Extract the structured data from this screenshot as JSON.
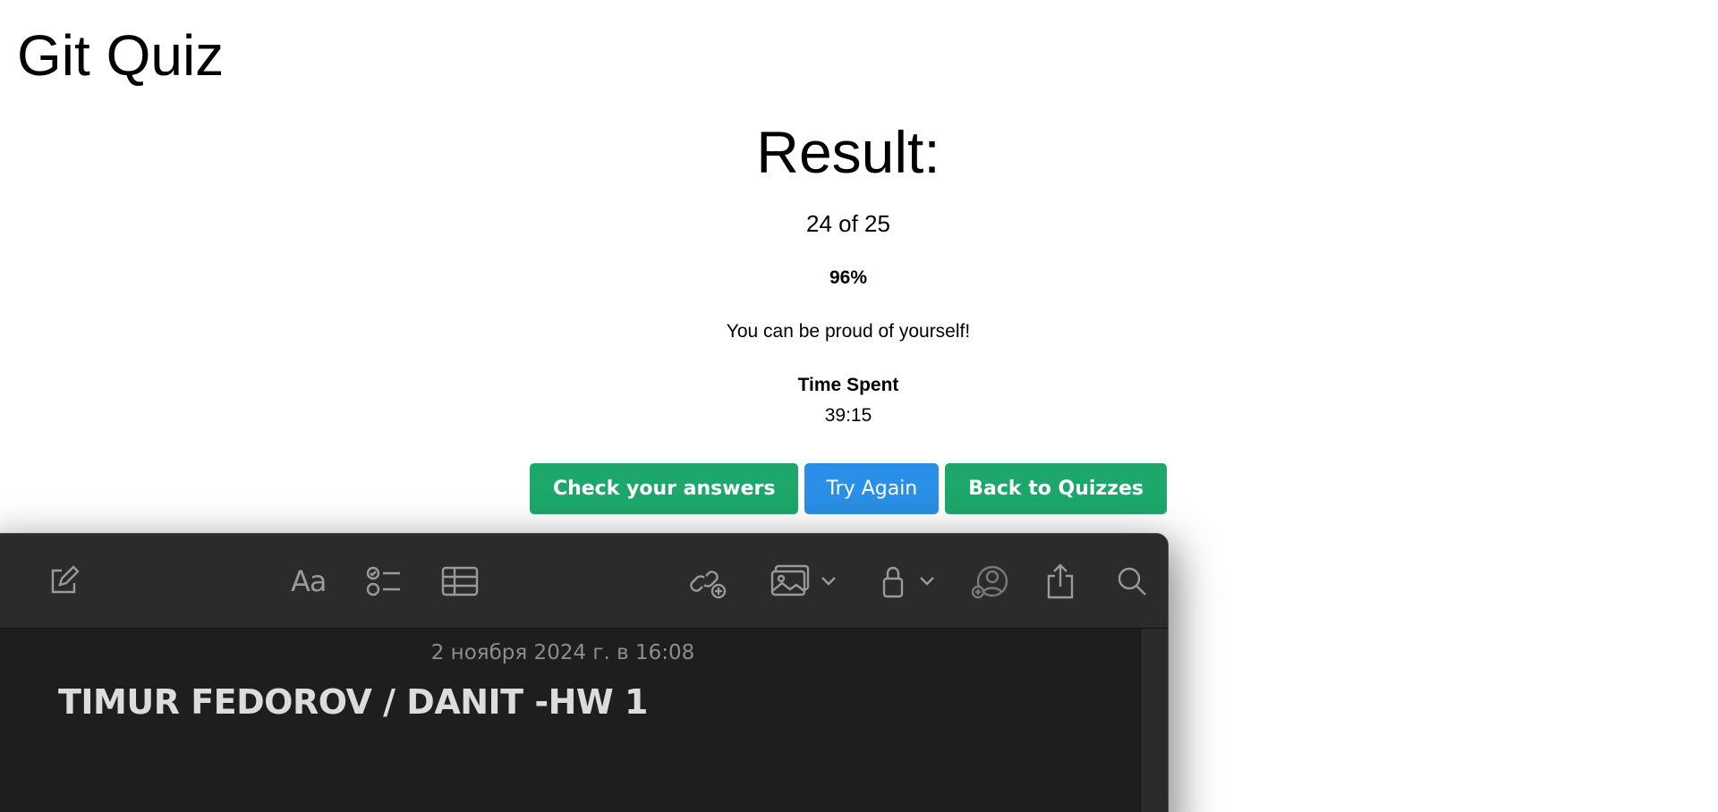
{
  "app": {
    "title": "Git Quiz"
  },
  "result": {
    "heading": "Result:",
    "score": "24 of 25",
    "percent": "96%",
    "message": "You can be proud of yourself!",
    "time_label": "Time Spent",
    "time_value": "39:15"
  },
  "buttons": {
    "check": "Check your answers",
    "try_again": "Try Again",
    "back": "Back to Quizzes"
  },
  "colors": {
    "green": "#1da76b",
    "blue": "#2a8fe6",
    "notes_bg": "#1e1e1e",
    "toolbar_bg": "#2b2b2b"
  },
  "notes": {
    "toolbar_icons": [
      "compose-icon",
      "format-text-icon",
      "checklist-icon",
      "table-icon",
      "link-add-icon",
      "media-icon",
      "chevron-down-icon",
      "lock-icon",
      "chevron-down-icon",
      "collaborate-icon",
      "share-icon",
      "search-icon"
    ],
    "format_label": "Aa",
    "date": "2 ноября 2024 г. в 16:08",
    "title": "TIMUR FEDOROV / DANIT -HW 1"
  }
}
